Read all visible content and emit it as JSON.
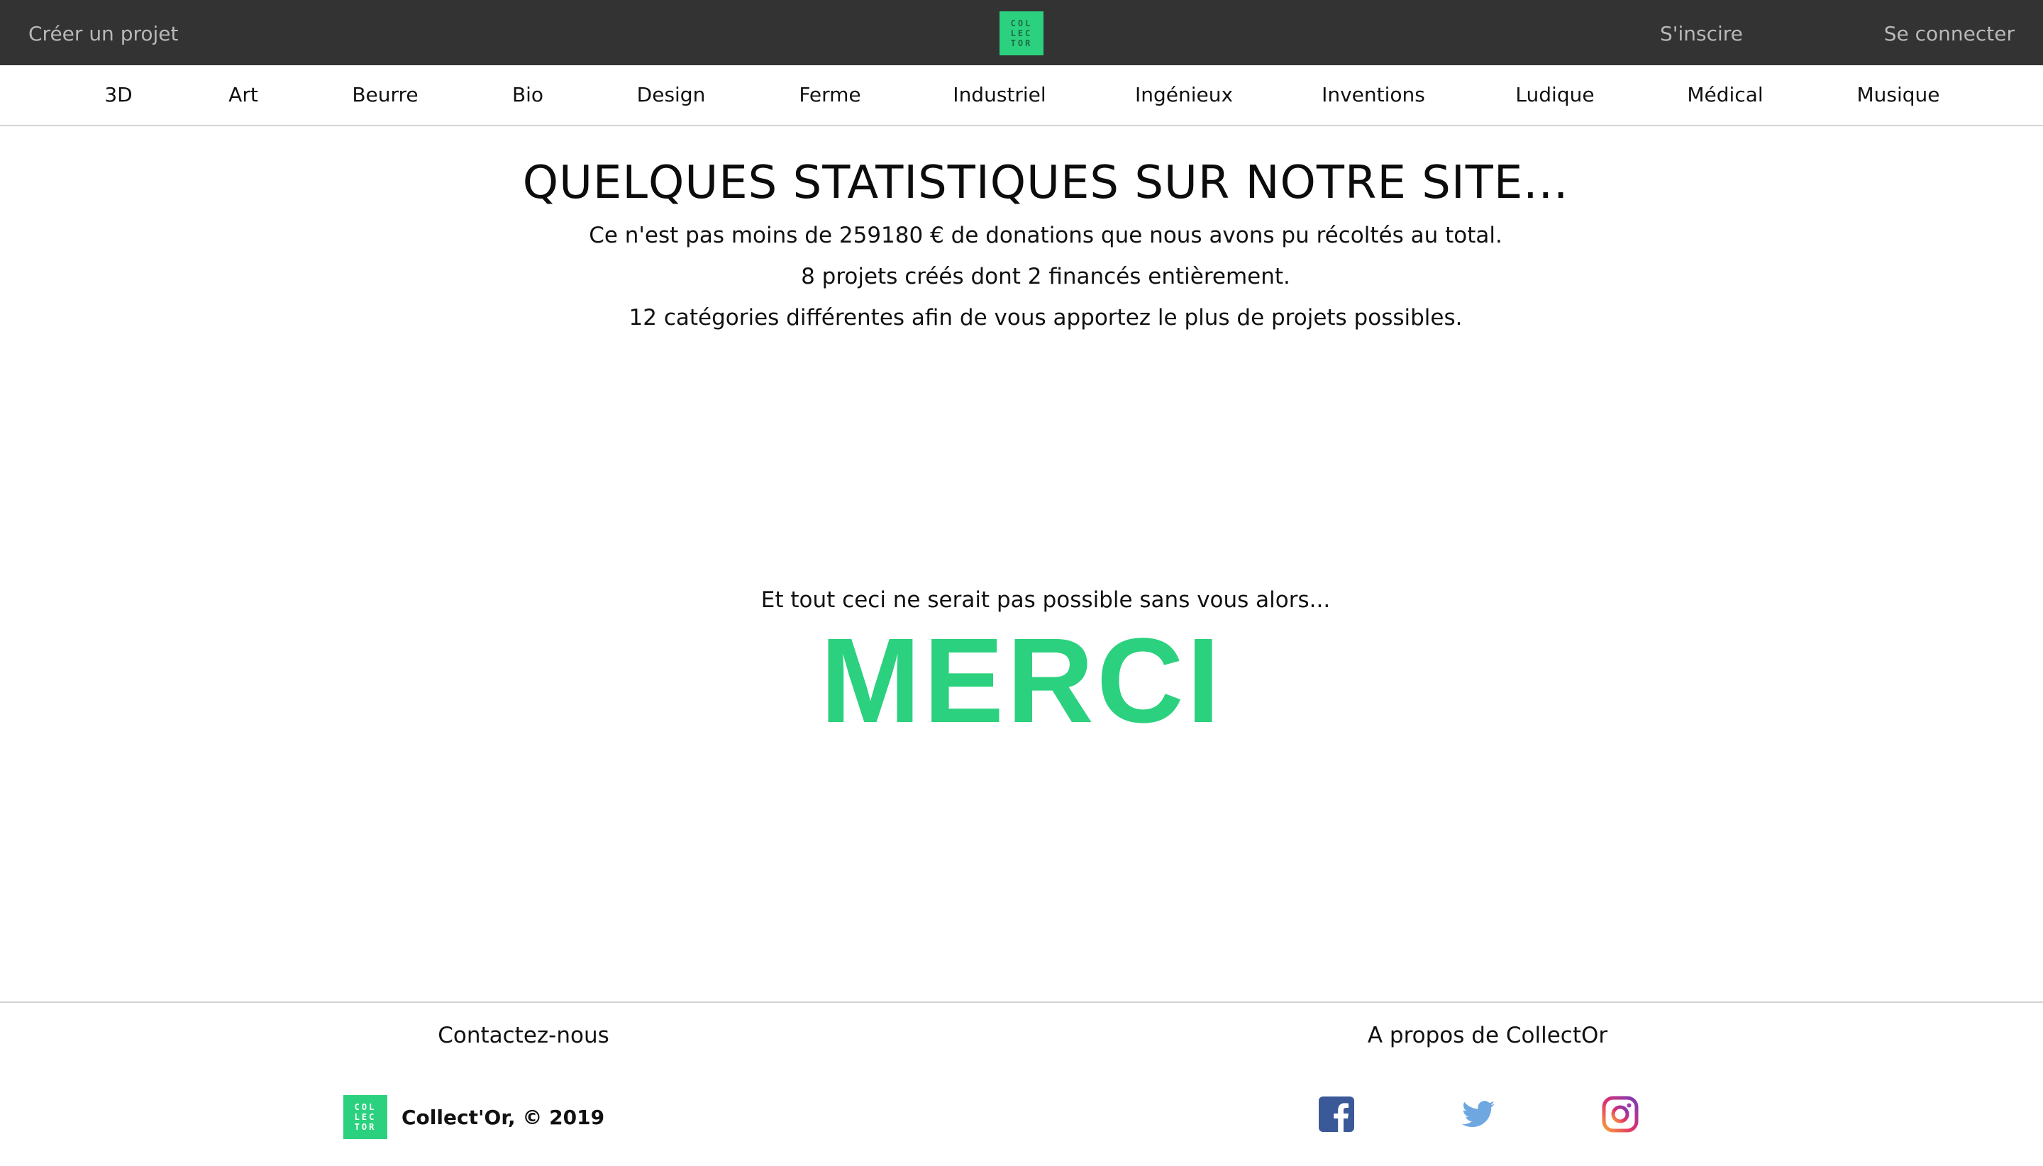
{
  "header": {
    "create_project": "Créer un projet",
    "logo_lines": [
      "COL",
      "LEC",
      "TOR"
    ],
    "signup": "S'inscire",
    "login": "Se connecter"
  },
  "categories": [
    "3D",
    "Art",
    "Beurre",
    "Bio",
    "Design",
    "Ferme",
    "Industriel",
    "Ingénieux",
    "Inventions",
    "Ludique",
    "Médical",
    "Musique"
  ],
  "main": {
    "title": "QUELQUES STATISTIQUES SUR NOTRE SITE...",
    "stats": [
      "Ce n'est pas moins de 259180 € de donations que nous avons pu récoltés au total.",
      "8 projets créés dont 2 financés entièrement.",
      "12 catégories différentes afin de vous apportez le plus de projets possibles."
    ],
    "thanks_lead": "Et tout ceci ne serait pas possible sans vous alors...",
    "thanks_big": "MERCI"
  },
  "footer": {
    "contact": "Contactez-nous",
    "about": "A propos de CollectOr",
    "copyright": "Collect'Or, © 2019",
    "social": [
      "facebook-icon",
      "twitter-icon",
      "instagram-icon"
    ]
  },
  "colors": {
    "topbar_bg": "#333333",
    "accent_green": "#2bd17e",
    "facebook": "#3b5998",
    "twitter": "#6fa8e0"
  }
}
